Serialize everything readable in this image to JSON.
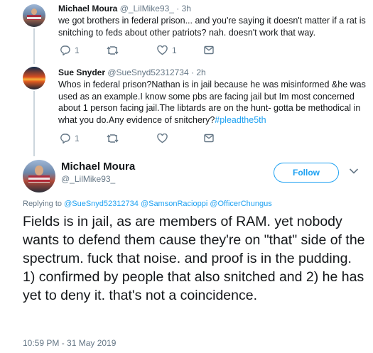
{
  "tweets": [
    {
      "name": "Michael Moura",
      "handle": "@_LilMike93_",
      "sep": "·",
      "time": "3h",
      "text": "we got brothers in federal prison... and you're saying it doesn't matter if a rat is snitching to feds about other patriots? nah. doesn't work that way.",
      "reply_count": "1",
      "retweet_count": "",
      "like_count": "1"
    },
    {
      "name": "Sue Snyder",
      "handle": "@SueSnyd52312734",
      "sep": "·",
      "time": "2h",
      "text": "Whos in federal prison?Nathan is in jail because he was misinformed &he was used as an example.I know some pbs are facing jail but Im most concerned about 1 person facing jail.The libtards are on the hunt- gotta be methodical in what you do.Any evidence of snitchery?",
      "hashtag": "#pleadthe5th",
      "reply_count": "1",
      "retweet_count": "",
      "like_count": ""
    }
  ],
  "main_tweet": {
    "name": "Michael Moura",
    "handle": "@_LilMike93_",
    "follow_label": "Follow",
    "replying_to_label": "Replying to",
    "mentions": [
      "@SueSnyd52312734",
      "@SamsonRacioppi",
      "@OfficerChungus"
    ],
    "text": "Fields is in jail, as are members of RAM. yet nobody wants to defend them cause they're on \"that\" side of the spectrum. fuck that noise. and proof is in the pudding. 1) confirmed by people that also snitched and 2) he has yet to deny it. that's not a coincidence.",
    "timestamp": "10:59 PM - 31 May 2019"
  },
  "icons": [
    "reply-icon",
    "retweet-icon",
    "like-icon",
    "message-icon",
    "chevron-down-icon"
  ],
  "colors": {
    "accent": "#1da1f2",
    "secondary_text": "#657786",
    "thread_line": "#ccd6dd"
  }
}
